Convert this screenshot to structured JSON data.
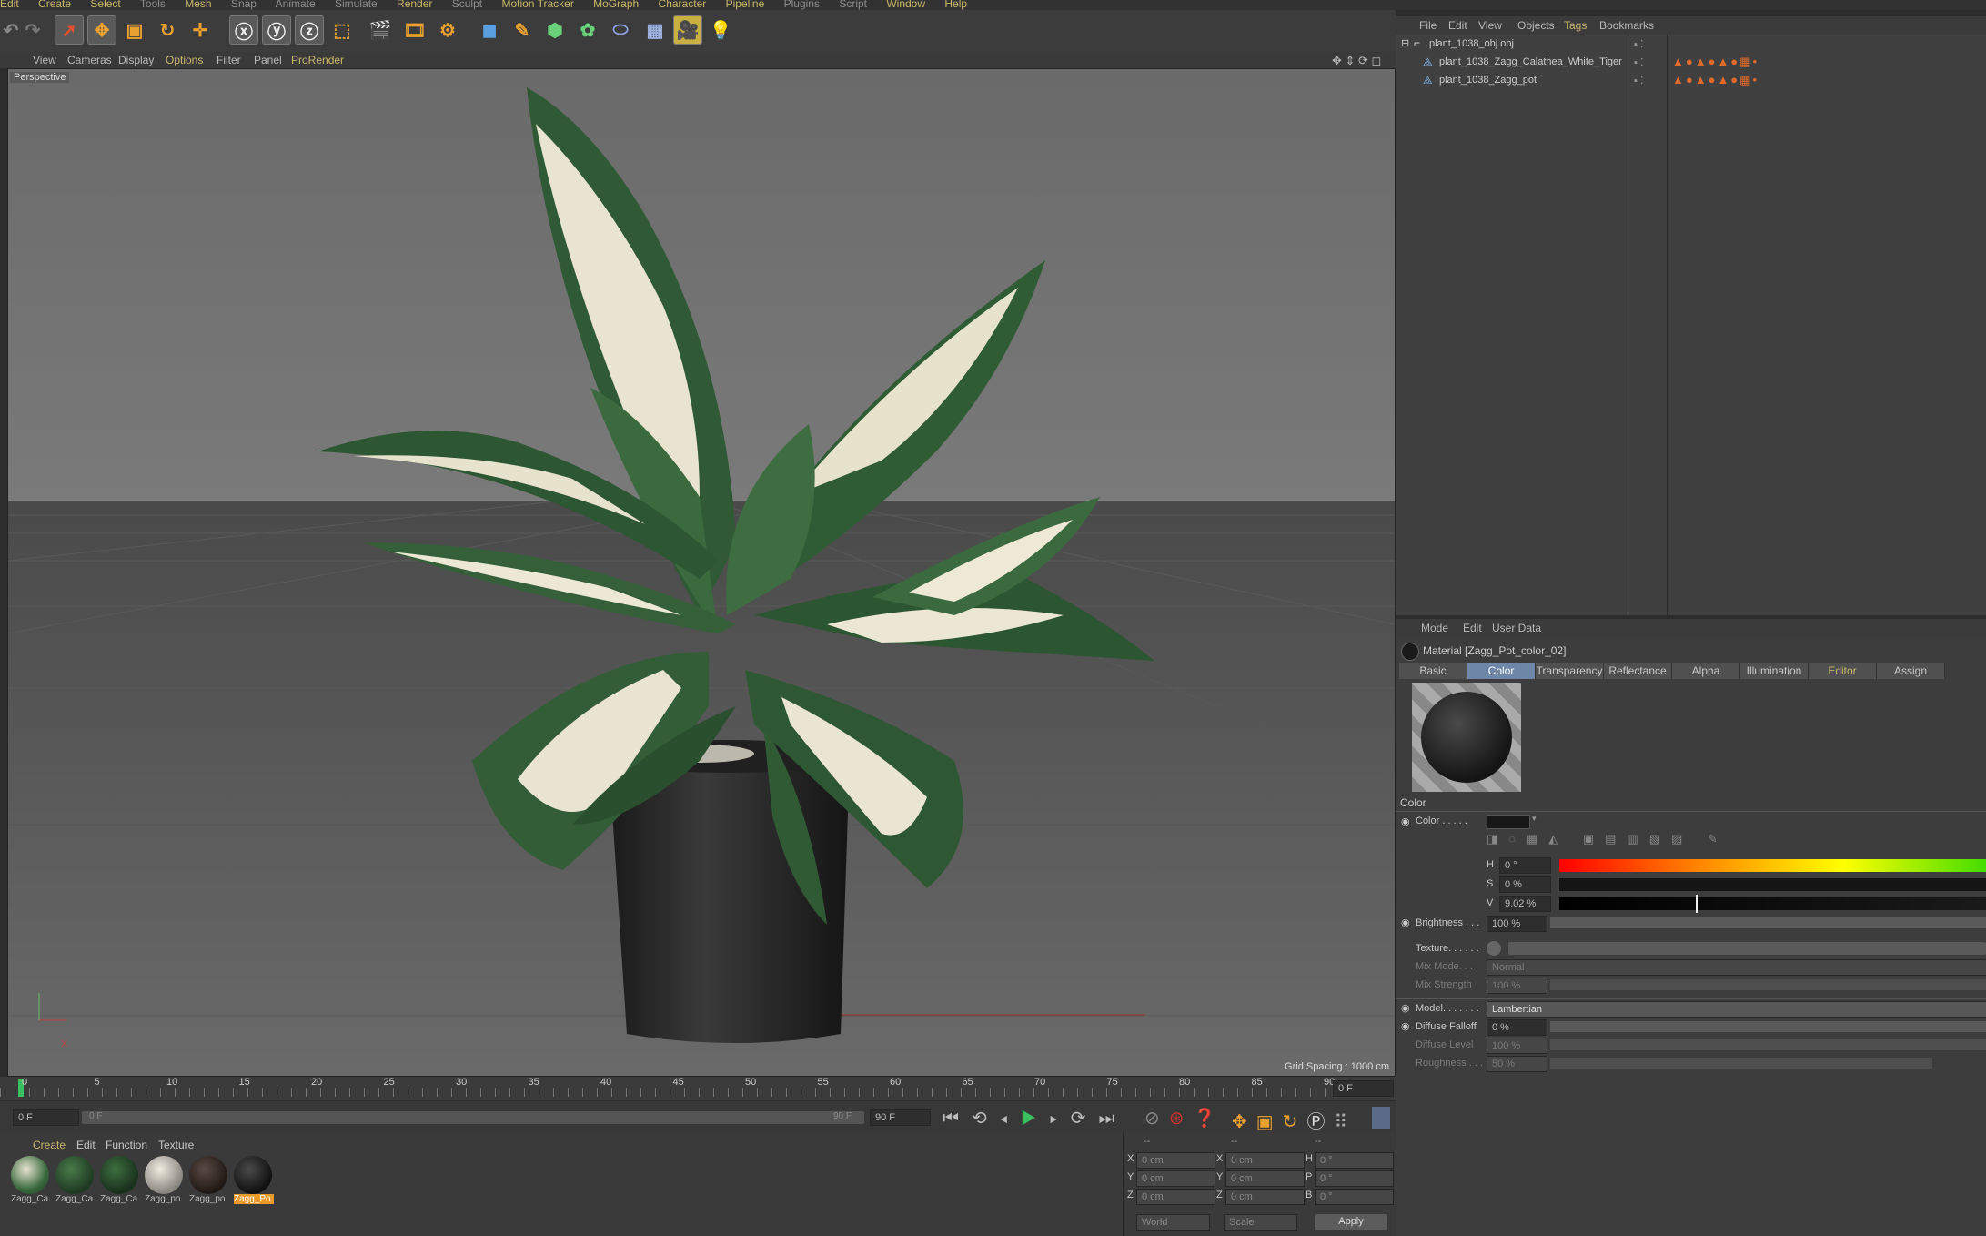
{
  "menubar": {
    "items": [
      "Edit",
      "Create",
      "Select",
      "Tools",
      "Mesh",
      "Snap",
      "Animate",
      "Simulate",
      "Render",
      "Sculpt",
      "Motion Tracker",
      "MoGraph",
      "Character",
      "Pipeline",
      "Plugins",
      "Script",
      "Window",
      "Help"
    ]
  },
  "viewport": {
    "menu": [
      "View",
      "Cameras",
      "Display",
      "Options",
      "Filter",
      "Panel",
      "ProRender"
    ],
    "label": "Perspective",
    "grid_spacing": "Grid Spacing : 1000 cm"
  },
  "object_manager": {
    "menu": [
      "File",
      "Edit",
      "View",
      "Objects",
      "Tags",
      "Bookmarks"
    ],
    "objects": [
      {
        "name": "plant_1038_obj.obj"
      },
      {
        "name": "plant_1038_Zagg_Calathea_White_Tiger"
      },
      {
        "name": "plant_1038_Zagg_pot"
      }
    ]
  },
  "attributes": {
    "menu": [
      "Mode",
      "Edit",
      "User Data"
    ],
    "material_title": "Material [Zagg_Pot_color_02]",
    "tabs": [
      "Basic",
      "Color",
      "Transparency",
      "Reflectance",
      "Alpha",
      "Illumination",
      "Editor",
      "Assign"
    ],
    "section": "Color",
    "color_label": "Color . . . . .",
    "h_label": "H",
    "h_value": "0 °",
    "s_label": "S",
    "s_value": "0 %",
    "v_label": "V",
    "v_value": "9.02 %",
    "brightness_label": "Brightness . . .",
    "brightness_value": "100 %",
    "texture_label": "Texture. . . . . .",
    "mixmode_label": "Mix Mode. . . .",
    "mixmode_value": "Normal",
    "mixstrength_label": "Mix Strength",
    "mixstrength_value": "100 %",
    "model_label": "Model. . . . . . .",
    "model_value": "Lambertian",
    "falloff_label": "Diffuse Falloff",
    "falloff_value": "0 %",
    "level_label": "Diffuse Level",
    "level_value": "100 %",
    "rough_label": "Roughness . . .",
    "rough_value": "50 %"
  },
  "timeline": {
    "ticks": [
      "0",
      "5",
      "10",
      "15",
      "20",
      "25",
      "30",
      "35",
      "40",
      "45",
      "50",
      "55",
      "60",
      "65",
      "70",
      "75",
      "80",
      "85",
      "90"
    ],
    "end_field": "0 F",
    "start_field": "0 F",
    "range_start": "0 F",
    "range_end": "90 F",
    "max_field": "90 F"
  },
  "material_manager": {
    "menu": [
      "Create",
      "Edit",
      "Function",
      "Texture"
    ],
    "materials": [
      "Zagg_Ca",
      "Zagg_Ca",
      "Zagg_Ca",
      "Zagg_po",
      "Zagg_po",
      "Zagg_Po"
    ]
  },
  "coordinates": {
    "header": [
      "--",
      "--",
      "--"
    ],
    "rows": [
      {
        "a": "X",
        "av": "0 cm",
        "b": "X",
        "bv": "0 cm",
        "c": "H",
        "cv": "0 °"
      },
      {
        "a": "Y",
        "av": "0 cm",
        "b": "Y",
        "bv": "0 cm",
        "c": "P",
        "cv": "0 °"
      },
      {
        "a": "Z",
        "av": "0 cm",
        "b": "Z",
        "bv": "0 cm",
        "c": "B",
        "cv": "0 °"
      }
    ],
    "world": "World",
    "scale": "Scale",
    "apply": "Apply"
  },
  "colors": {
    "accent": "#c9b86a",
    "active_tab": "#6e86a8",
    "selected_material": "#e89a2a"
  }
}
